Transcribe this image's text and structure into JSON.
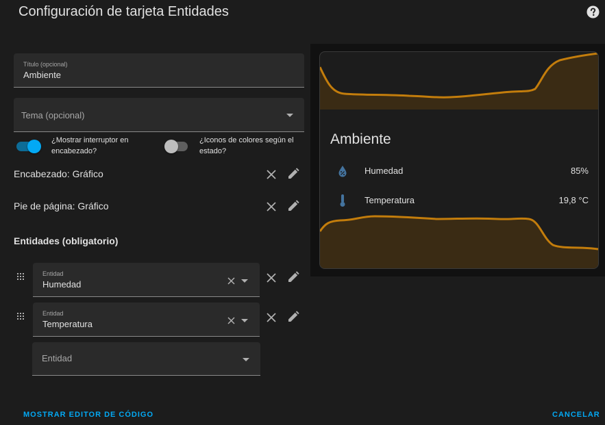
{
  "dialog": {
    "title": "Configuración de tarjeta Entidades",
    "help_icon": "help-circle-icon"
  },
  "editor": {
    "title_field": {
      "label": "Título (opcional)",
      "value": "Ambiente"
    },
    "theme_field": {
      "placeholder": "Tema (opcional)"
    },
    "toggles": [
      {
        "label_line1": "¿Mostrar interruptor en",
        "label_line2": "encabezado?",
        "on": true
      },
      {
        "label_line1": "¿Iconos de colores según el",
        "label_line2": "estado?",
        "on": false
      }
    ],
    "header_row": "Encabezado: Gráfico",
    "footer_row": "Pie de página: Gráfico",
    "entities_title": "Entidades (obligatorio)",
    "entity_rows": [
      {
        "label": "Entidad",
        "value": "Humedad"
      },
      {
        "label": "Entidad",
        "value": "Temperatura"
      }
    ],
    "new_entity_placeholder": "Entidad"
  },
  "preview": {
    "card_title": "Ambiente",
    "entities": [
      {
        "name": "Humedad",
        "state": "85%",
        "icon": "water-percent-icon"
      },
      {
        "name": "Temperatura",
        "state": "19,8 °C",
        "icon": "thermometer-icon"
      }
    ],
    "graph_color": "#c37d0c"
  },
  "actions": {
    "show_code_editor": "MOSTRAR EDITOR DE CÓDIGO",
    "cancel": "CANCELAR"
  },
  "colors": {
    "accent": "#03a9f4",
    "background": "#1c1c1c",
    "field": "#2a2a2a"
  }
}
